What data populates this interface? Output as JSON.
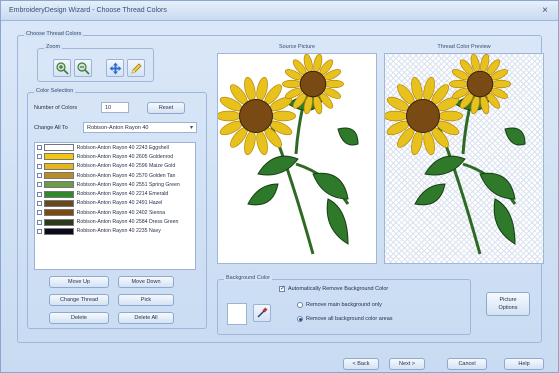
{
  "window": {
    "title": "EmbroideryDesign Wizard - Choose Thread Colors",
    "close_glyph": "×"
  },
  "outer_group": {
    "label": "Choose Thread Colors"
  },
  "zoom": {
    "label": "Zoom",
    "buttons": [
      {
        "name": "zoom-in-icon"
      },
      {
        "name": "zoom-out-icon"
      },
      {
        "name": "pan-icon"
      },
      {
        "name": "pencil-icon"
      }
    ]
  },
  "color_selection": {
    "label": "Color Selection",
    "num_colors_label": "Number of Colors",
    "num_colors_value": "10",
    "reset_label": "Reset",
    "change_all_label": "Change All To",
    "change_all_value": "Robison-Anton Rayon 40",
    "threads": [
      {
        "name": "Robison-Anton Rayon 40 2243 Eggshell",
        "color": "#ffffff"
      },
      {
        "name": "Robison-Anton Rayon 40 2605 Goldenrod",
        "color": "#f2c80f"
      },
      {
        "name": "Robison-Anton Rayon 40 2596 Maize Gold",
        "color": "#e6b41e"
      },
      {
        "name": "Robison-Anton Rayon 40 2570 Golden Tan",
        "color": "#b98c2a"
      },
      {
        "name": "Robison-Anton Rayon 40 2551 Spring Green",
        "color": "#6f9a49"
      },
      {
        "name": "Robison-Anton Rayon 40 2214 Emerald",
        "color": "#2e8a2a"
      },
      {
        "name": "Robison-Anton Rayon 40 2491 Hazel",
        "color": "#6a4a1a"
      },
      {
        "name": "Robison-Anton Rayon 40 2402 Sienna",
        "color": "#7a4a12"
      },
      {
        "name": "Robison-Anton Rayon 40 2584 Dress Green",
        "color": "#2a3a1a"
      },
      {
        "name": "Robison-Anton Rayon 40 2235 Navy",
        "color": "#0a0a1a"
      }
    ],
    "buttons": {
      "move_up": "Move Up",
      "move_down": "Move Down",
      "change_thread": "Change Thread",
      "pick": "Pick",
      "delete": "Delete",
      "delete_all": "Delete All"
    }
  },
  "source_picture": {
    "title": "Source Picture"
  },
  "thread_preview": {
    "title": "Thread Color Preview"
  },
  "background_color": {
    "label": "Background Color",
    "auto_remove": "Automatically Remove Background Color",
    "auto_remove_checked": true,
    "remove_main": "Remove main background only",
    "remove_all": "Remove all background color areas",
    "selected_option": "remove_all",
    "picture_options": [
      "Picture",
      "Options"
    ]
  },
  "footer": {
    "back": "< Back",
    "next": "Next >",
    "cancel": "Cancel",
    "help": "Help"
  },
  "colors": {
    "petal": "#e8c21c",
    "petal_dark": "#b8860b",
    "center": "#7a4a14",
    "leaf": "#2f7a2a",
    "leaf_light": "#5aa844",
    "stem": "#2f6a24"
  }
}
